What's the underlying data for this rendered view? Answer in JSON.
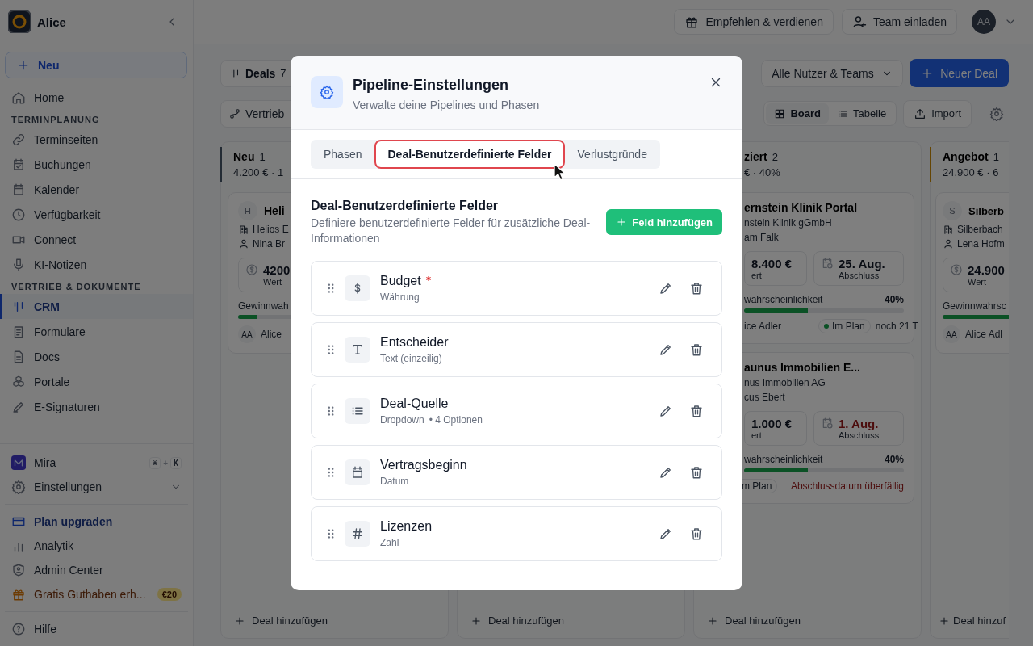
{
  "app": {
    "workspace": "Alice"
  },
  "header_actions": [
    {
      "label": "Empfehlen & verdienen",
      "kind": "gift"
    },
    {
      "label": "Team einladen",
      "kind": "user-plus"
    }
  ],
  "user": {
    "initials": "AA"
  },
  "sidebar": {
    "new_button": "Neu",
    "items": [
      {
        "kind": "link",
        "label": "Home",
        "selected": false
      },
      {
        "kind": "section",
        "label": "TERMINPLANUNG"
      },
      {
        "kind": "link",
        "label": "Terminseiten",
        "selected": false
      },
      {
        "kind": "link",
        "label": "Buchungen",
        "selected": false
      },
      {
        "kind": "link",
        "label": "Kalender",
        "selected": false
      },
      {
        "kind": "link",
        "label": "Verfügbarkeit",
        "selected": false
      },
      {
        "kind": "link",
        "label": "Connect",
        "selected": false
      },
      {
        "kind": "link",
        "label": "KI-Notizen",
        "selected": false
      },
      {
        "kind": "section",
        "label": "VERTRIEB & DOKUMENTE"
      },
      {
        "kind": "link",
        "label": "CRM",
        "selected": true
      },
      {
        "kind": "link",
        "label": "Formulare",
        "selected": false
      },
      {
        "kind": "link",
        "label": "Docs",
        "selected": false
      },
      {
        "kind": "link",
        "label": "Portale",
        "selected": false
      },
      {
        "kind": "link",
        "label": "E-Signaturen",
        "selected": false
      }
    ],
    "assistant": {
      "label": "Mira",
      "shortcut_keys": [
        "⌘",
        "K"
      ],
      "shortcut_joiner": "+"
    },
    "settings": {
      "label": "Einstellungen",
      "expanded": false
    },
    "bottom_items": [
      {
        "kind": "upgrade",
        "label": "Plan upgraden"
      },
      {
        "kind": "link",
        "label": "Analytik"
      },
      {
        "kind": "link",
        "label": "Admin Center"
      },
      {
        "kind": "promo",
        "label": "Gratis Guthaben erh...",
        "badge": "€20"
      }
    ],
    "help": "Hilfe"
  },
  "toolbar": {
    "deals_label": "Deals",
    "deals_count": "7",
    "pipeline": "Vertrieb",
    "filter": "Alle Nutzer & Teams",
    "new_deal": "Neuer Deal",
    "views": [
      {
        "label": "Board",
        "selected": true
      },
      {
        "label": "Tabelle",
        "selected": false
      }
    ],
    "import": "Import"
  },
  "columns": [
    {
      "name": "Neu",
      "count": "1",
      "stats": "4.200 € · 1",
      "color": "#232b34",
      "add": "Deal hinzufügen",
      "cards": [
        {
          "avatar": "H",
          "title": "Heli",
          "company": "Helios E",
          "contact": "Nina Br",
          "value": "4200",
          "value_label": "Wert",
          "prob_label": "Gewinnwah",
          "level": 0.1,
          "owner_initials": "AA",
          "owner": "Alice"
        }
      ]
    },
    {
      "add": "Deal hinzufügen"
    },
    {
      "name": "ziert",
      "count": "2",
      "stats": "€ · 40%",
      "add": "Deal hinzufügen",
      "cards": [
        {
          "title": "ernstein Klinik Portal",
          "company": "nstein Klinik gGmbH",
          "contact": "am Falk",
          "value": "8.400 €",
          "value_label": "ert",
          "date": "25. Aug.",
          "date_label": "Abschluss",
          "overdue": false,
          "prob_label": "wahrscheinlichkeit",
          "prob_value": "40%",
          "level": 0.4,
          "owner": "ice Adler",
          "status": {
            "label": "Im Plan",
            "color": "#0b5125"
          },
          "due": "noch 21 T"
        },
        {
          "title": "aunus Immobilien E...",
          "company": "nus Immobilien AG",
          "contact": "cus Ebert",
          "value": "1.000 €",
          "value_label": "ert",
          "date": "1. Aug.",
          "date_label": "Abschluss",
          "overdue": true,
          "prob_label": "wahrscheinlichkeit",
          "prob_value": "40%",
          "level": 0.4,
          "status": {
            "label": "m Plan"
          },
          "due": "Abschlussdatum überfällig"
        }
      ]
    },
    {
      "name": "Angebot",
      "count": "1",
      "stats": "24.900 € · 6",
      "color": "#654502",
      "add": "Deal hinzuf",
      "cards": [
        {
          "avatar": "S",
          "title": "Silberb",
          "company": "Silberbach",
          "contact": "Lena Hofm",
          "value": "24.900",
          "value_label": "Wert",
          "prob_label": "Gewinnwahrsc",
          "level": 0.6,
          "owner_initials": "AA",
          "owner": "Alice Adl"
        }
      ]
    }
  ],
  "modal": {
    "title": "Pipeline-Einstellungen",
    "subtitle": "Verwalte deine Pipelines und Phasen",
    "tabs": [
      {
        "label": "Phasen",
        "selected": false
      },
      {
        "label": "Deal-Benutzerdefinierte Felder",
        "selected": true
      },
      {
        "label": "Verlustgründe",
        "selected": false
      }
    ],
    "section_title": "Deal-Benutzerdefinierte Felder",
    "section_description": "Definiere benutzerdefinierte Felder für zusätzliche Deal-Informationen",
    "add_button": "Feld hinzufügen",
    "fields": [
      {
        "name": "Budget",
        "type": "Währung",
        "kind": "currency",
        "required": true
      },
      {
        "name": "Entscheider",
        "type": "Text (einzeilig)",
        "kind": "text",
        "required": false
      },
      {
        "name": "Deal-Quelle",
        "type": "Dropdown",
        "detail": "• 4 Optionen",
        "kind": "dropdown",
        "required": false
      },
      {
        "name": "Vertragsbeginn",
        "type": "Datum",
        "kind": "date",
        "required": false
      },
      {
        "name": "Lizenzen",
        "type": "Zahl",
        "kind": "number",
        "required": false
      }
    ]
  }
}
